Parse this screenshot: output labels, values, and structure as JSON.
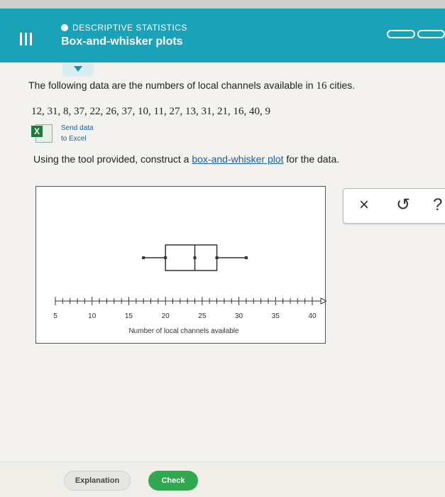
{
  "header": {
    "topic": "DESCRIPTIVE STATISTICS",
    "title": "Box-and-whisker plots"
  },
  "question": {
    "prompt_prefix": "The following data are the numbers of local channels available in",
    "prompt_number": "16",
    "prompt_suffix": "cities.",
    "data_values": "12, 31, 8, 37, 22, 26, 37, 10, 11, 27, 13, 31, 21, 16, 40, 9",
    "send_data_line1": "Send data",
    "send_data_line2": "to Excel",
    "instruction_prefix": "Using the tool provided, construct a",
    "instruction_link": "box-and-whisker plot",
    "instruction_suffix": "for the data."
  },
  "tools": {
    "close_label": "×",
    "undo_label": "↺",
    "help_label": "?"
  },
  "buttons": {
    "explanation": "Explanation",
    "check": "Check"
  },
  "chart_data": {
    "type": "boxplot",
    "axis_min": 5,
    "axis_max": 40,
    "tick_step": 1,
    "tick_labels": [
      "5",
      "10",
      "15",
      "20",
      "25",
      "30",
      "35",
      "40"
    ],
    "xlabel": "Number of local channels available",
    "box": {
      "min": 17,
      "q1": 20,
      "median": 24,
      "q3": 27,
      "max": 31
    }
  },
  "colors": {
    "header": "#1aa3b8",
    "check_button": "#2fa84f",
    "link": "#1a5fa0"
  }
}
